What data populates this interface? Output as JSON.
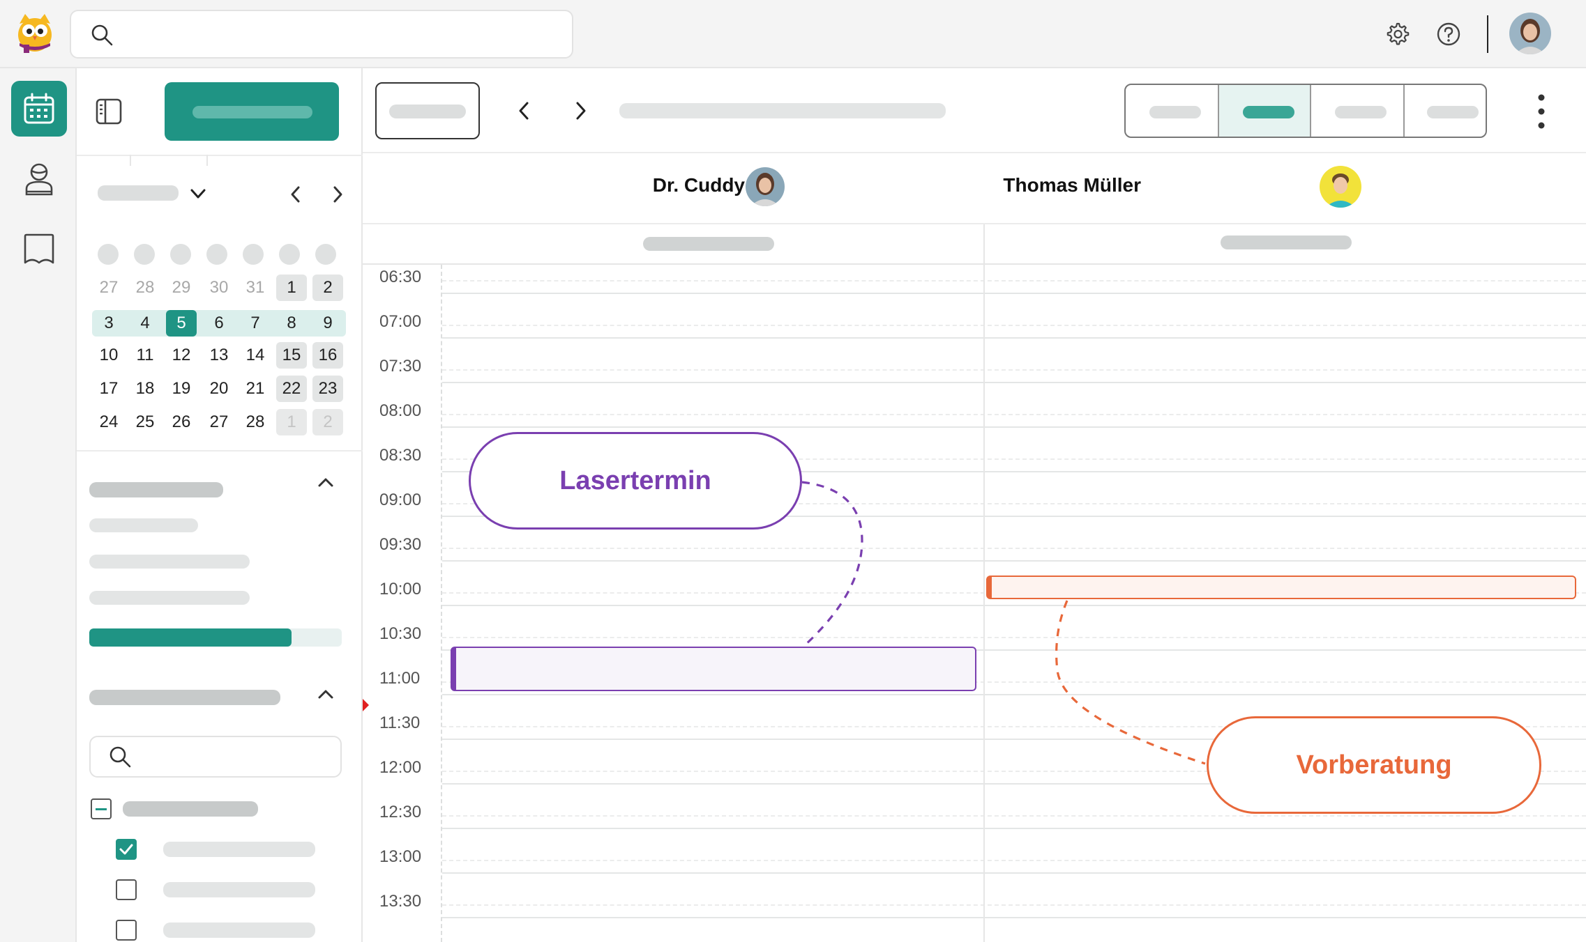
{
  "colors": {
    "brand": "#1f9484",
    "brand_light": "#dbefec",
    "purple": "#7a3fb0",
    "orange": "#e8683a",
    "now_marker": "#e02020"
  },
  "icons": {
    "logo": "owl-logo-icon",
    "search": "search-icon",
    "settings": "gear-icon",
    "help": "help-icon",
    "calendar": "calendar-icon",
    "person": "person-icon",
    "book": "book-icon",
    "sidebar_toggle": "sidebar-toggle-icon",
    "prev": "chevron-left-icon",
    "next": "chevron-right-icon",
    "more": "more-vertical-icon"
  },
  "mini_calendar": {
    "weeks": [
      [
        {
          "d": "27",
          "muted": true
        },
        {
          "d": "28",
          "muted": true
        },
        {
          "d": "29",
          "muted": true
        },
        {
          "d": "30",
          "muted": true
        },
        {
          "d": "31",
          "muted": true
        },
        {
          "d": "1",
          "weekend": true
        },
        {
          "d": "2",
          "weekend": true
        }
      ],
      [
        {
          "d": "3",
          "week": true
        },
        {
          "d": "4",
          "week": true
        },
        {
          "d": "5",
          "selected": true
        },
        {
          "d": "6",
          "week": true
        },
        {
          "d": "7",
          "week": true
        },
        {
          "d": "8",
          "week": true
        },
        {
          "d": "9",
          "week": true
        }
      ],
      [
        {
          "d": "10"
        },
        {
          "d": "11"
        },
        {
          "d": "12"
        },
        {
          "d": "13"
        },
        {
          "d": "14"
        },
        {
          "d": "15",
          "weekend": true
        },
        {
          "d": "16",
          "weekend": true
        }
      ],
      [
        {
          "d": "17"
        },
        {
          "d": "18"
        },
        {
          "d": "19"
        },
        {
          "d": "20"
        },
        {
          "d": "21"
        },
        {
          "d": "22",
          "weekend": true
        },
        {
          "d": "23",
          "weekend": true
        }
      ],
      [
        {
          "d": "24"
        },
        {
          "d": "25"
        },
        {
          "d": "26"
        },
        {
          "d": "27"
        },
        {
          "d": "28"
        },
        {
          "d": "1",
          "weekend": true,
          "muted": true
        },
        {
          "d": "2",
          "weekend": true,
          "muted": true
        }
      ]
    ]
  },
  "sidebar": {
    "progress_fraction": 0.8
  },
  "columns": [
    {
      "name": "Dr. Cuddy"
    },
    {
      "name": "Thomas Müller"
    }
  ],
  "times": [
    "06:30",
    "07:00",
    "07:30",
    "08:00",
    "08:30",
    "09:00",
    "09:30",
    "10:00",
    "10:30",
    "11:00",
    "11:30",
    "12:00",
    "12:30",
    "13:00",
    "13:30"
  ],
  "callouts": {
    "laser": "Lasertermin",
    "vorberatung": "Vorberatung"
  }
}
